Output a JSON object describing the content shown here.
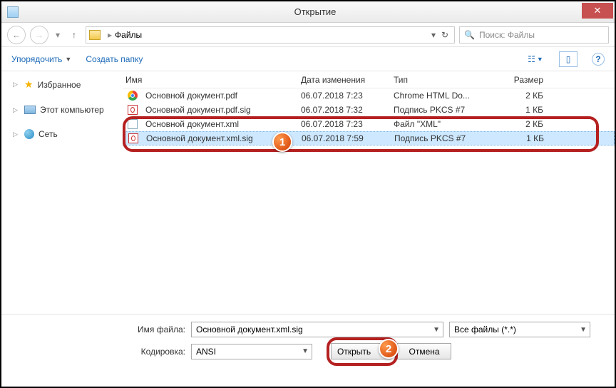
{
  "window": {
    "title": "Открытие"
  },
  "nav": {
    "crumb": "Файлы",
    "search_placeholder": "Поиск: Файлы"
  },
  "toolbar": {
    "organize": "Упорядочить",
    "new_folder": "Создать папку"
  },
  "sidebar": {
    "favorites": "Избранное",
    "computer": "Этот компьютер",
    "network": "Сеть"
  },
  "columns": {
    "name": "Имя",
    "date": "Дата изменения",
    "type": "Тип",
    "size": "Размер"
  },
  "files": [
    {
      "name": "Основной документ.pdf",
      "date": "06.07.2018 7:23",
      "type": "Chrome HTML Do...",
      "size": "2 КБ",
      "icon": "chrome"
    },
    {
      "name": "Основной документ.pdf.sig",
      "date": "06.07.2018 7:32",
      "type": "Подпись PKCS #7",
      "size": "1 КБ",
      "icon": "sig"
    },
    {
      "name": "Основной документ.xml",
      "date": "06.07.2018 7:23",
      "type": "Файл \"XML\"",
      "size": "2 КБ",
      "icon": "xml"
    },
    {
      "name": "Основной документ.xml.sig",
      "date": "06.07.2018 7:59",
      "type": "Подпись PKCS #7",
      "size": "1 КБ",
      "icon": "sig"
    }
  ],
  "form": {
    "filename_label_pre": "Имя файла:",
    "filename_value": "Основной документ.xml.sig",
    "filter_value": "Все файлы (*.*)",
    "encoding_label_pre": "Кодировка:",
    "encoding_value": "ANSI",
    "open_pre": "О",
    "open_underline": "т",
    "open_post": "крыть",
    "cancel": "Отмена"
  },
  "callouts": {
    "b1": "1",
    "b2": "2"
  }
}
